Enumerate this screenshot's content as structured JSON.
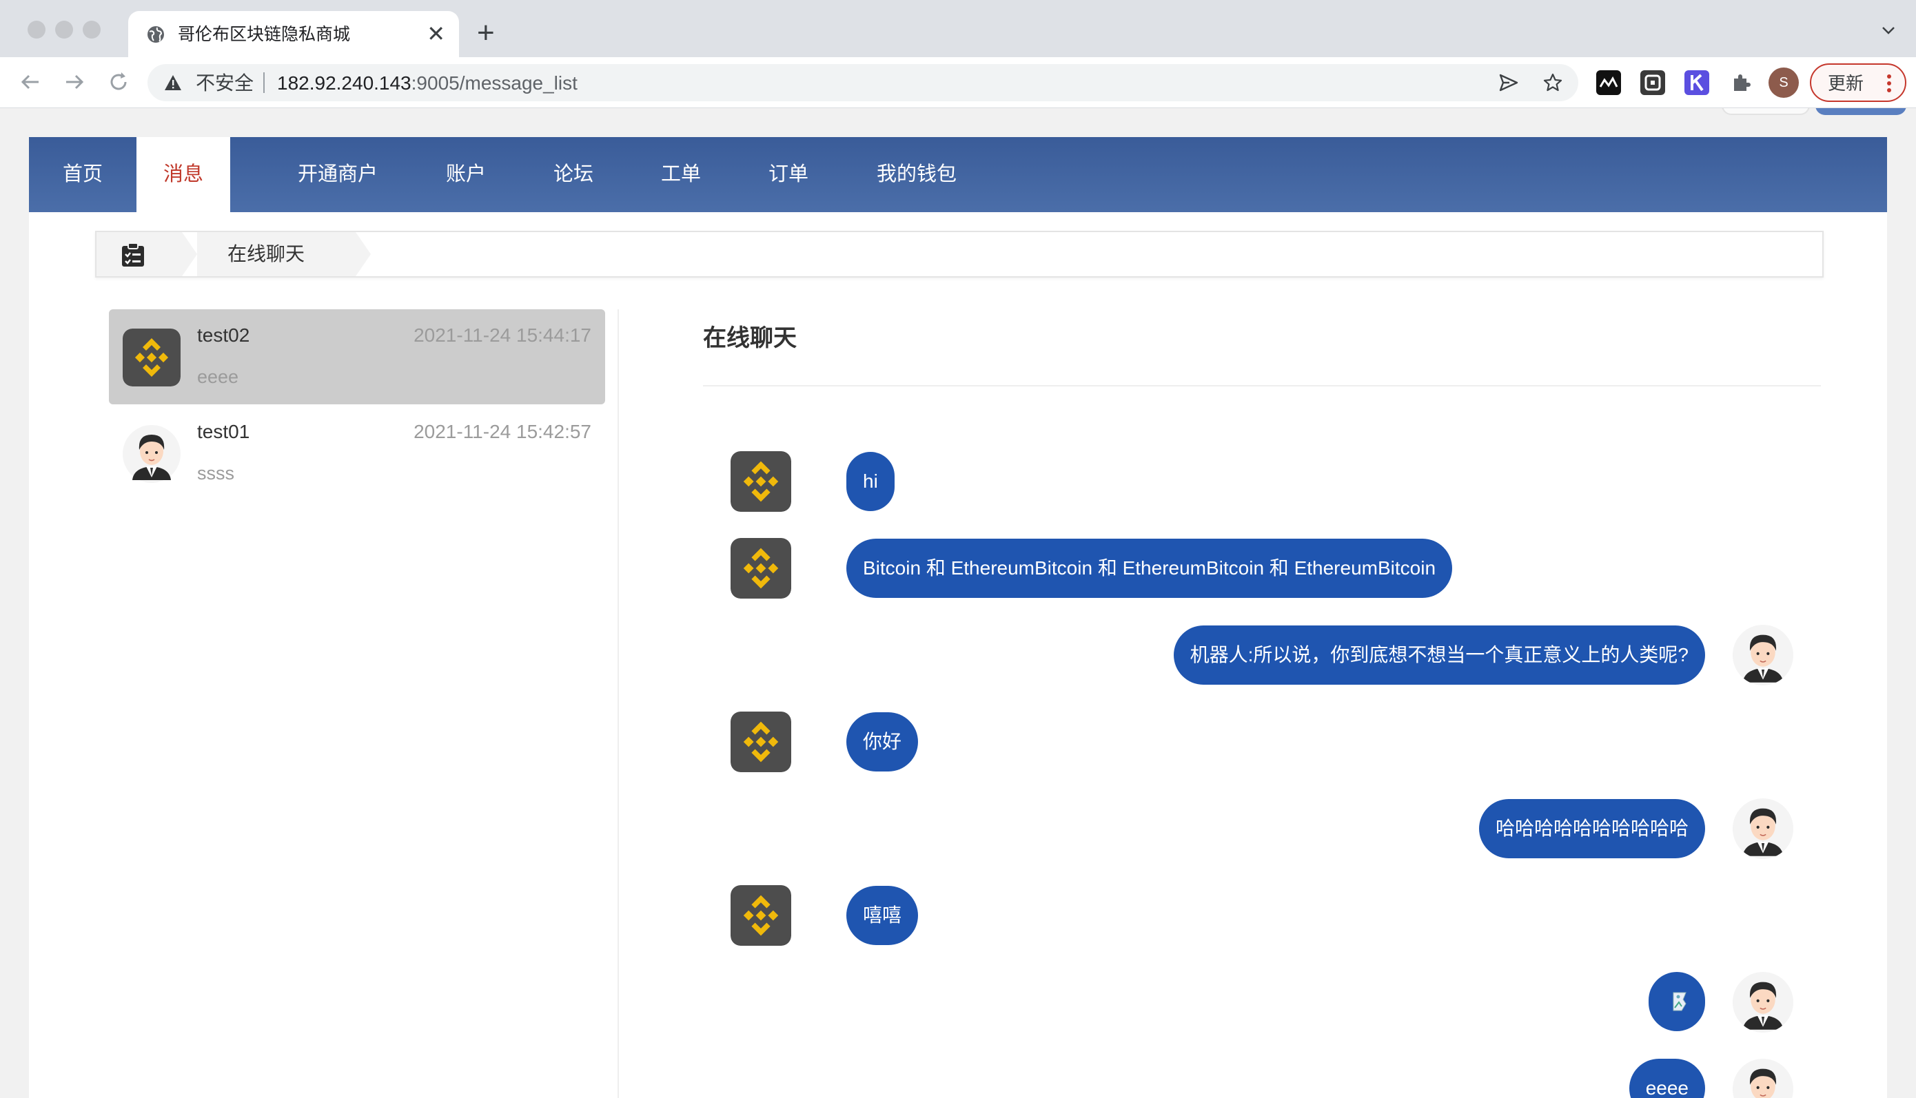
{
  "browser": {
    "tab_title": "哥伦布区块链隐私商城",
    "security_label": "不安全",
    "url_host": "182.92.240.143",
    "url_rest": ":9005/message_list",
    "profile_initial": "S",
    "update_label": "更新"
  },
  "nav": {
    "items": [
      "首页",
      "消息",
      "开通商户",
      "账户",
      "论坛",
      "工单",
      "订单",
      "我的钱包"
    ],
    "active": "消息"
  },
  "breadcrumb": {
    "current": "在线聊天"
  },
  "conversations": [
    {
      "name": "test02",
      "time": "2021-11-24 15:44:17",
      "preview": "eeee",
      "avatar": "binance-logo",
      "selected": true
    },
    {
      "name": "test01",
      "time": "2021-11-24 15:42:57",
      "preview": "ssss",
      "avatar": "user-avatar",
      "selected": false
    }
  ],
  "chat": {
    "title": "在线聊天",
    "messages": [
      {
        "side": "left",
        "text": "hi"
      },
      {
        "side": "left",
        "text": "Bitcoin 和 EthereumBitcoin 和 EthereumBitcoin 和 EthereumBitcoin"
      },
      {
        "side": "right",
        "text": "机器人:所以说，你到底想不想当一个真正意义上的人类呢?"
      },
      {
        "side": "left",
        "text": "你好"
      },
      {
        "side": "right",
        "text": "哈哈哈哈哈哈哈哈哈哈"
      },
      {
        "side": "left",
        "text": "嘻嘻"
      },
      {
        "side": "right",
        "text": "",
        "type": "broken-image"
      },
      {
        "side": "right",
        "text": "eeee"
      }
    ]
  },
  "colors": {
    "nav_bar": "#4466a3",
    "nav_active_text": "#c0392b",
    "bubble": "#1f55b0",
    "binance_bg": "#4d4d4d",
    "binance_gold": "#f0b90b"
  }
}
